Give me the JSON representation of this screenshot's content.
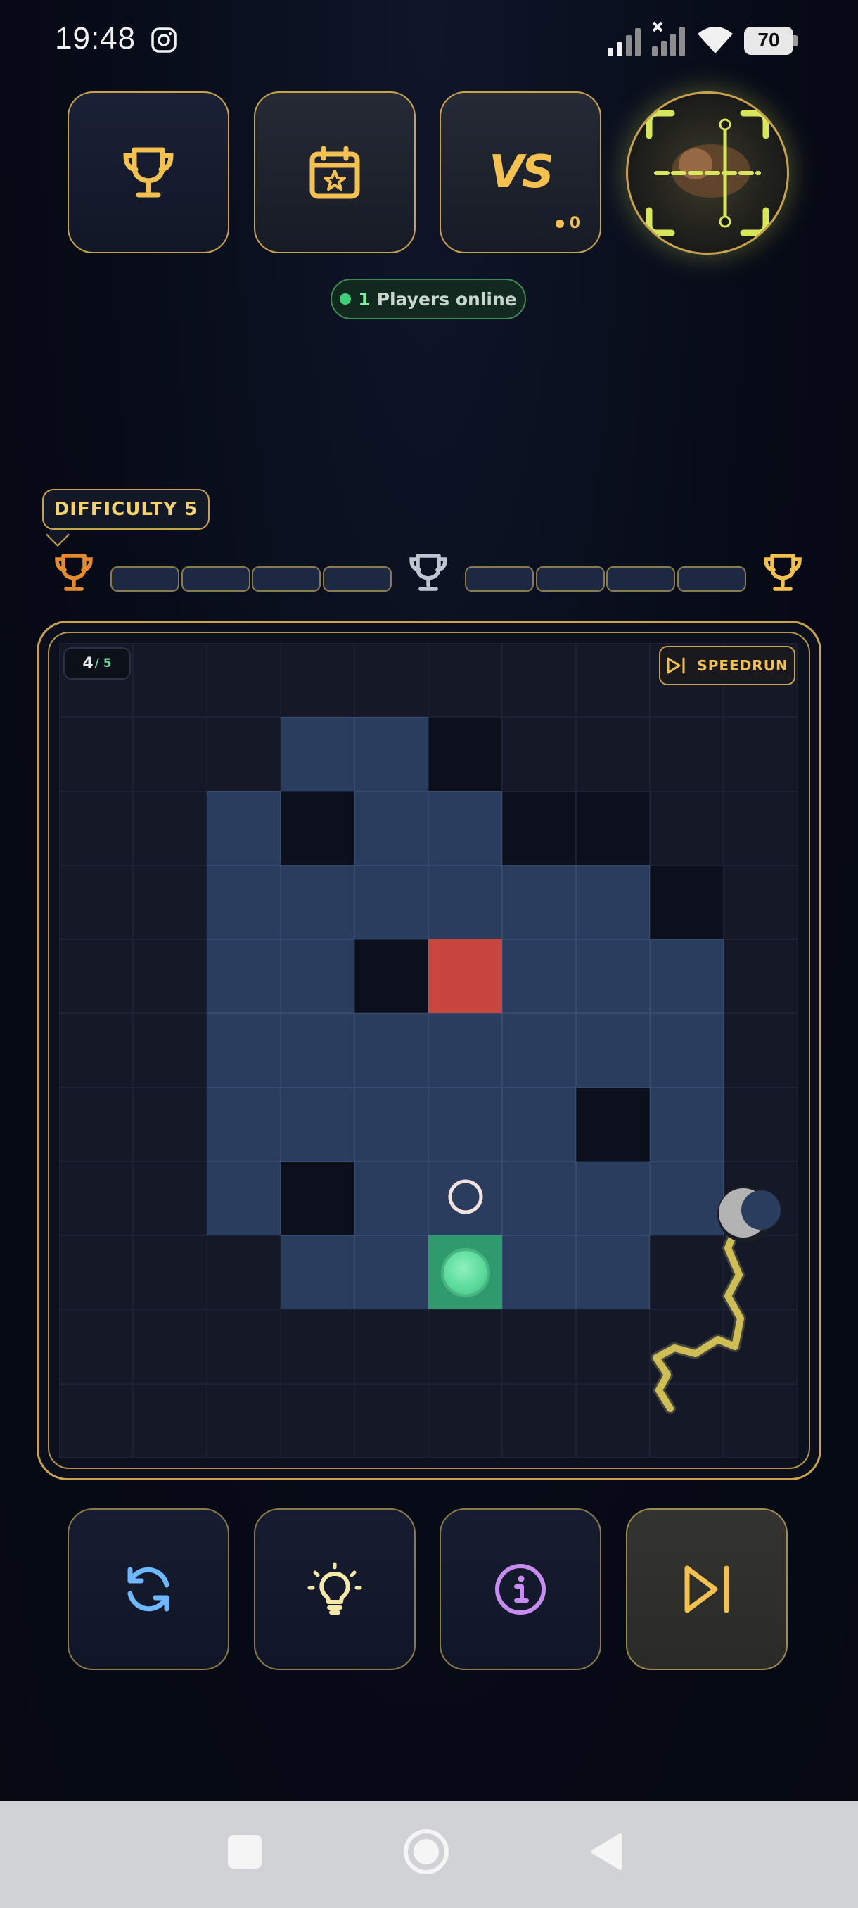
{
  "status_bar": {
    "time": "19:48",
    "battery": "70",
    "icons": [
      "instagram-icon",
      "signal-icon",
      "signal-no-service-icon",
      "wifi-icon",
      "battery-icon"
    ]
  },
  "top_buttons": {
    "leaderboard_icon": "trophy-icon",
    "daily_icon": "calendar-star-icon",
    "vs_label": "VS",
    "vs_count": "0",
    "scan_icon": "scan-frame-icon"
  },
  "online": {
    "count": "1",
    "label": "Players online"
  },
  "difficulty": {
    "label": "DIFFICULTY 5",
    "milestones": [
      "trophy-bronze",
      "trophy-silver",
      "trophy-gold"
    ],
    "segments_filled": 0,
    "segments_total": 8
  },
  "board": {
    "level_current": "4",
    "level_total": "/ 5",
    "speedrun_label": "SPEEDRUN",
    "rows": 11,
    "cols": 10,
    "grid": [
      "dddddddddd",
      "dddbbvdddd",
      "ddbvbbvvdd",
      "ddbbbbbbvd",
      "ddbbvRbbbd",
      "ddbbbbbbbd",
      "ddbbbbbvbd",
      "ddbvbbbbbd",
      "dddbbGbbdd",
      "dddddddddd",
      "dddddddddd"
    ],
    "legend": {
      "d": "empty",
      "v": "void",
      "b": "path-tile",
      "R": "target-ring",
      "G": "start-orb"
    }
  },
  "bottom_buttons": {
    "restart_icon": "refresh-icon",
    "hint_icon": "lightbulb-icon",
    "info_icon": "info-icon",
    "skip_icon": "skip-forward-icon"
  },
  "colors": {
    "accent_gold": "#c9a24e",
    "tile_blue": "#2b3d5f",
    "target_red": "#c9463f",
    "start_green": "#2f9a6e",
    "lightning": "#e7d35a"
  }
}
